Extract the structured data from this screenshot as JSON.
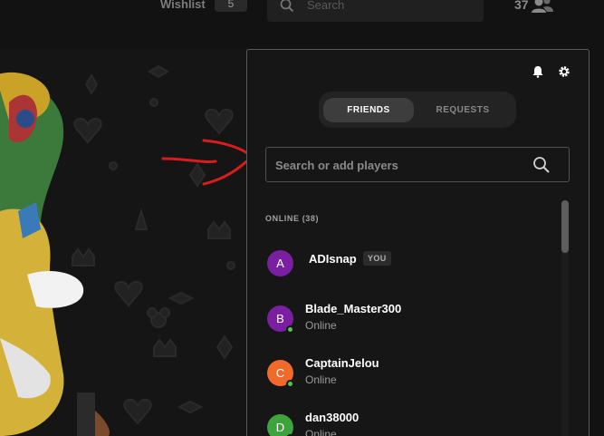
{
  "header": {
    "wishlist_label": "Wishlist",
    "wishlist_count": "5",
    "search_placeholder": "Search",
    "friends_online_count": "37"
  },
  "friends_panel": {
    "tabs": [
      {
        "label": "FRIENDS",
        "active": true
      },
      {
        "label": "REQUESTS",
        "active": false
      }
    ],
    "search_placeholder": "Search or add players",
    "online_header": "ONLINE (38)",
    "you_badge": "YOU",
    "friends": [
      {
        "initial": "A",
        "name": "ADIsnap",
        "status": "",
        "is_you": true,
        "avatar_color": "#7a1fa2"
      },
      {
        "initial": "B",
        "name": "Blade_Master300",
        "status": "Online",
        "is_you": false,
        "avatar_color": "#7a1fa2"
      },
      {
        "initial": "C",
        "name": "CaptainJelou",
        "status": "Online",
        "is_you": false,
        "avatar_color": "#f26a2a"
      },
      {
        "initial": "D",
        "name": "dan38000",
        "status": "Online",
        "is_you": false,
        "avatar_color": "#3da33d"
      }
    ]
  },
  "colors": {
    "online_status": "#4ec84e",
    "annotation_arrow": "#d91c1c"
  },
  "icons": [
    "search-icon",
    "bell-icon",
    "gear-icon",
    "friends-icon"
  ]
}
